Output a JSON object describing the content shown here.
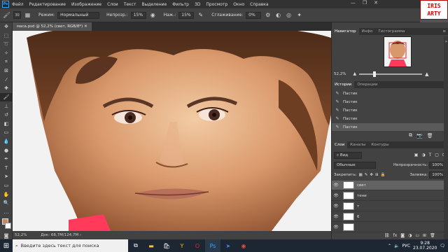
{
  "menu": [
    "Файл",
    "Редактирование",
    "Изображение",
    "Слои",
    "Текст",
    "Выделение",
    "Фильтр",
    "3D",
    "Просмотр",
    "Окно",
    "Справка"
  ],
  "window_controls": [
    "—",
    "❐",
    "✕"
  ],
  "watermark": {
    "line1": "IRIS",
    "line2": "ARTY"
  },
  "options": {
    "brush_size": "30",
    "mode_label": "Режим:",
    "mode_value": "Нормальный",
    "opacity_label": "Непрозр.:",
    "opacity_value": "15%",
    "pressure_label": "Наж.:",
    "pressure_value": "15%",
    "smoothing_label": "Сглаживание:",
    "smoothing_value": "0%"
  },
  "document": {
    "tab_title": "маса.psd @ 52,2% (свет, RGB/8*)",
    "zoom": "52,2%",
    "doc_info": "Док: 68,7M/124,7M"
  },
  "navigator": {
    "tabs": [
      "Навигатор",
      "Инфо",
      "Гистограмма"
    ],
    "zoom": "52,2%"
  },
  "history": {
    "tabs": [
      "Истории",
      "Операции"
    ],
    "items": [
      "Пастик",
      "Пастик",
      "Пастик",
      "Пастик",
      "Пастик"
    ]
  },
  "layers": {
    "tabs": [
      "Слои",
      "Каналы",
      "Контуры"
    ],
    "filter": "Вид",
    "blend": "Обычные",
    "opacity_label": "Непрозрачность:",
    "opacity_value": "100%",
    "lock_label": "Закрепить:",
    "fill_label": "Заливка:",
    "fill_value": "100%",
    "items": [
      "свет",
      "тени",
      "т",
      "б",
      ""
    ]
  },
  "taskbar": {
    "search_placeholder": "Введите здесь текст для поиска",
    "language": "РУС",
    "time": "9:28",
    "date": "23.07.2020"
  },
  "colors": {
    "accent": "#31a8ff",
    "panel": "#424242",
    "bar": "#323232",
    "taskbar": "#1c2733"
  }
}
